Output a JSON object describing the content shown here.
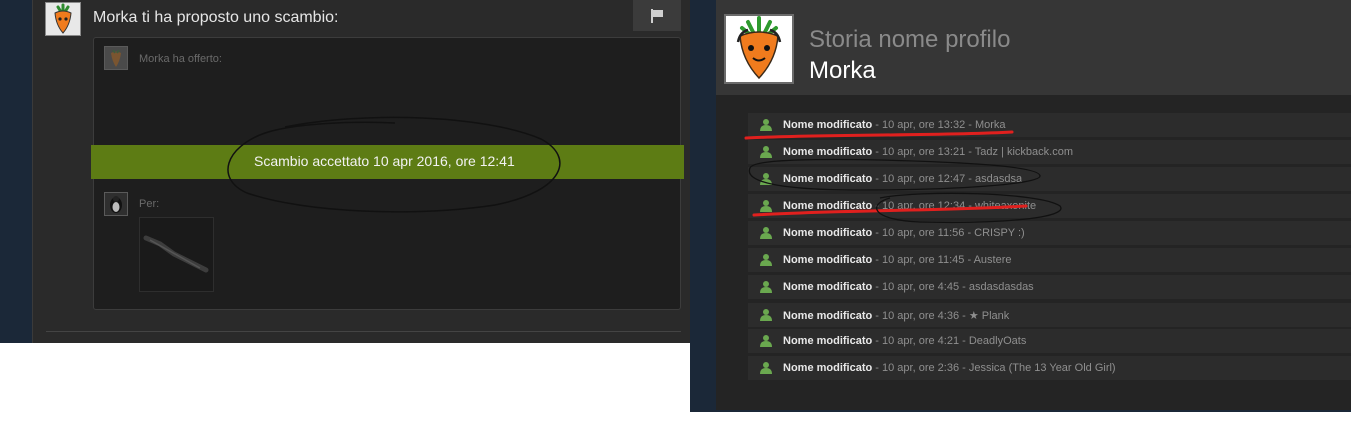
{
  "trade_offer": {
    "title": "Morka ti ha proposto uno scambio:",
    "offered_label": "Morka ha offerto:",
    "status": "Scambio accettato 10 apr 2016, ore 12:41",
    "for_label": "Per:"
  },
  "name_history": {
    "title": "Storia nome profilo",
    "current_name": "Morka",
    "entries": [
      {
        "action": "Nome modificato",
        "time": "10 apr, ore 13:32",
        "name": "Morka"
      },
      {
        "action": "Nome modificato",
        "time": "10 apr, ore 13:21",
        "name": "Tadz | kickback.com"
      },
      {
        "action": "Nome modificato",
        "time": "10 apr, ore 12:47",
        "name": "asdasdsa"
      },
      {
        "action": "Nome modificato",
        "time": "10 apr, ore 12:34",
        "name": "whiteaxonite"
      },
      {
        "action": "Nome modificato",
        "time": "10 apr, ore 11:56",
        "name": "CRISPY :)"
      },
      {
        "action": "Nome modificato",
        "time": "10 apr, ore 11:45",
        "name": "Austere"
      },
      {
        "action": "Nome modificato",
        "time": "10 apr, ore 4:45",
        "name": "asdasdasdas"
      },
      {
        "action": "Nome modificato",
        "time": "10 apr, ore 4:36",
        "name": "★ Plank"
      },
      {
        "action": "Nome modificato",
        "time": "10 apr, ore 4:21",
        "name": "DeadlyOats"
      },
      {
        "action": "Nome modificato",
        "time": "10 apr, ore 2:36",
        "name": "Jessica (The 13 Year Old Girl)"
      }
    ]
  },
  "icons": {
    "flag": "flag-icon",
    "person": "person-icon",
    "avatar": "carrot-avatar"
  },
  "colors": {
    "accepted": "#5d7c14",
    "person_icon": "#6aa84f",
    "annotation_red": "#e0201e"
  }
}
